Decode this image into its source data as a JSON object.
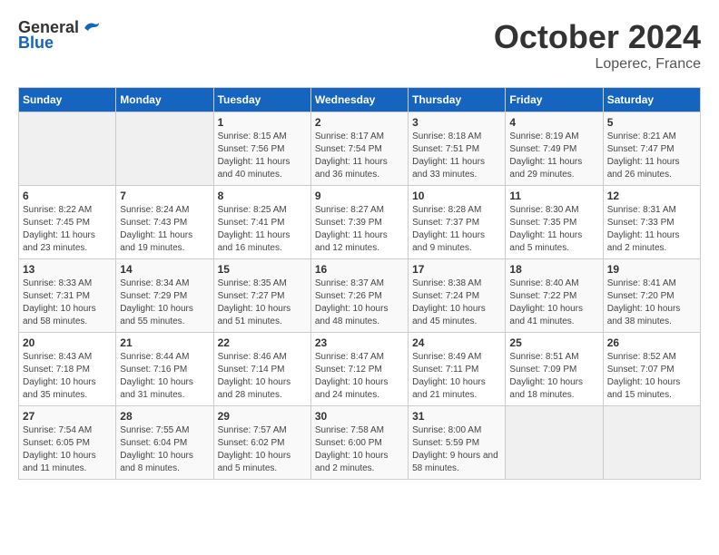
{
  "header": {
    "logo_general": "General",
    "logo_blue": "Blue",
    "month": "October 2024",
    "location": "Loperec, France"
  },
  "weekdays": [
    "Sunday",
    "Monday",
    "Tuesday",
    "Wednesday",
    "Thursday",
    "Friday",
    "Saturday"
  ],
  "weeks": [
    [
      {
        "day": "",
        "sunrise": "",
        "sunset": "",
        "daylight": ""
      },
      {
        "day": "",
        "sunrise": "",
        "sunset": "",
        "daylight": ""
      },
      {
        "day": "1",
        "sunrise": "Sunrise: 8:15 AM",
        "sunset": "Sunset: 7:56 PM",
        "daylight": "Daylight: 11 hours and 40 minutes."
      },
      {
        "day": "2",
        "sunrise": "Sunrise: 8:17 AM",
        "sunset": "Sunset: 7:54 PM",
        "daylight": "Daylight: 11 hours and 36 minutes."
      },
      {
        "day": "3",
        "sunrise": "Sunrise: 8:18 AM",
        "sunset": "Sunset: 7:51 PM",
        "daylight": "Daylight: 11 hours and 33 minutes."
      },
      {
        "day": "4",
        "sunrise": "Sunrise: 8:19 AM",
        "sunset": "Sunset: 7:49 PM",
        "daylight": "Daylight: 11 hours and 29 minutes."
      },
      {
        "day": "5",
        "sunrise": "Sunrise: 8:21 AM",
        "sunset": "Sunset: 7:47 PM",
        "daylight": "Daylight: 11 hours and 26 minutes."
      }
    ],
    [
      {
        "day": "6",
        "sunrise": "Sunrise: 8:22 AM",
        "sunset": "Sunset: 7:45 PM",
        "daylight": "Daylight: 11 hours and 23 minutes."
      },
      {
        "day": "7",
        "sunrise": "Sunrise: 8:24 AM",
        "sunset": "Sunset: 7:43 PM",
        "daylight": "Daylight: 11 hours and 19 minutes."
      },
      {
        "day": "8",
        "sunrise": "Sunrise: 8:25 AM",
        "sunset": "Sunset: 7:41 PM",
        "daylight": "Daylight: 11 hours and 16 minutes."
      },
      {
        "day": "9",
        "sunrise": "Sunrise: 8:27 AM",
        "sunset": "Sunset: 7:39 PM",
        "daylight": "Daylight: 11 hours and 12 minutes."
      },
      {
        "day": "10",
        "sunrise": "Sunrise: 8:28 AM",
        "sunset": "Sunset: 7:37 PM",
        "daylight": "Daylight: 11 hours and 9 minutes."
      },
      {
        "day": "11",
        "sunrise": "Sunrise: 8:30 AM",
        "sunset": "Sunset: 7:35 PM",
        "daylight": "Daylight: 11 hours and 5 minutes."
      },
      {
        "day": "12",
        "sunrise": "Sunrise: 8:31 AM",
        "sunset": "Sunset: 7:33 PM",
        "daylight": "Daylight: 11 hours and 2 minutes."
      }
    ],
    [
      {
        "day": "13",
        "sunrise": "Sunrise: 8:33 AM",
        "sunset": "Sunset: 7:31 PM",
        "daylight": "Daylight: 10 hours and 58 minutes."
      },
      {
        "day": "14",
        "sunrise": "Sunrise: 8:34 AM",
        "sunset": "Sunset: 7:29 PM",
        "daylight": "Daylight: 10 hours and 55 minutes."
      },
      {
        "day": "15",
        "sunrise": "Sunrise: 8:35 AM",
        "sunset": "Sunset: 7:27 PM",
        "daylight": "Daylight: 10 hours and 51 minutes."
      },
      {
        "day": "16",
        "sunrise": "Sunrise: 8:37 AM",
        "sunset": "Sunset: 7:26 PM",
        "daylight": "Daylight: 10 hours and 48 minutes."
      },
      {
        "day": "17",
        "sunrise": "Sunrise: 8:38 AM",
        "sunset": "Sunset: 7:24 PM",
        "daylight": "Daylight: 10 hours and 45 minutes."
      },
      {
        "day": "18",
        "sunrise": "Sunrise: 8:40 AM",
        "sunset": "Sunset: 7:22 PM",
        "daylight": "Daylight: 10 hours and 41 minutes."
      },
      {
        "day": "19",
        "sunrise": "Sunrise: 8:41 AM",
        "sunset": "Sunset: 7:20 PM",
        "daylight": "Daylight: 10 hours and 38 minutes."
      }
    ],
    [
      {
        "day": "20",
        "sunrise": "Sunrise: 8:43 AM",
        "sunset": "Sunset: 7:18 PM",
        "daylight": "Daylight: 10 hours and 35 minutes."
      },
      {
        "day": "21",
        "sunrise": "Sunrise: 8:44 AM",
        "sunset": "Sunset: 7:16 PM",
        "daylight": "Daylight: 10 hours and 31 minutes."
      },
      {
        "day": "22",
        "sunrise": "Sunrise: 8:46 AM",
        "sunset": "Sunset: 7:14 PM",
        "daylight": "Daylight: 10 hours and 28 minutes."
      },
      {
        "day": "23",
        "sunrise": "Sunrise: 8:47 AM",
        "sunset": "Sunset: 7:12 PM",
        "daylight": "Daylight: 10 hours and 24 minutes."
      },
      {
        "day": "24",
        "sunrise": "Sunrise: 8:49 AM",
        "sunset": "Sunset: 7:11 PM",
        "daylight": "Daylight: 10 hours and 21 minutes."
      },
      {
        "day": "25",
        "sunrise": "Sunrise: 8:51 AM",
        "sunset": "Sunset: 7:09 PM",
        "daylight": "Daylight: 10 hours and 18 minutes."
      },
      {
        "day": "26",
        "sunrise": "Sunrise: 8:52 AM",
        "sunset": "Sunset: 7:07 PM",
        "daylight": "Daylight: 10 hours and 15 minutes."
      }
    ],
    [
      {
        "day": "27",
        "sunrise": "Sunrise: 7:54 AM",
        "sunset": "Sunset: 6:05 PM",
        "daylight": "Daylight: 10 hours and 11 minutes."
      },
      {
        "day": "28",
        "sunrise": "Sunrise: 7:55 AM",
        "sunset": "Sunset: 6:04 PM",
        "daylight": "Daylight: 10 hours and 8 minutes."
      },
      {
        "day": "29",
        "sunrise": "Sunrise: 7:57 AM",
        "sunset": "Sunset: 6:02 PM",
        "daylight": "Daylight: 10 hours and 5 minutes."
      },
      {
        "day": "30",
        "sunrise": "Sunrise: 7:58 AM",
        "sunset": "Sunset: 6:00 PM",
        "daylight": "Daylight: 10 hours and 2 minutes."
      },
      {
        "day": "31",
        "sunrise": "Sunrise: 8:00 AM",
        "sunset": "Sunset: 5:59 PM",
        "daylight": "Daylight: 9 hours and 58 minutes."
      },
      {
        "day": "",
        "sunrise": "",
        "sunset": "",
        "daylight": ""
      },
      {
        "day": "",
        "sunrise": "",
        "sunset": "",
        "daylight": ""
      }
    ]
  ]
}
